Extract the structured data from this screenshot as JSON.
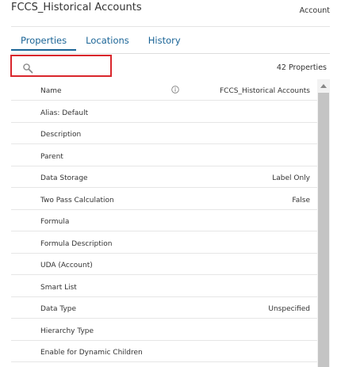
{
  "header": {
    "title": "FCCS_Historical Accounts",
    "member_type": "Account"
  },
  "tabs": [
    {
      "label": "Properties",
      "active": true
    },
    {
      "label": "Locations",
      "active": false
    },
    {
      "label": "History",
      "active": false
    }
  ],
  "search": {
    "icon": "search-icon",
    "value": "",
    "highlight_color": "#d9262c"
  },
  "property_count": "42 Properties",
  "properties": [
    {
      "name": "Name",
      "value": "FCCS_Historical Accounts",
      "has_info": true
    },
    {
      "name": "Alias: Default",
      "value": ""
    },
    {
      "name": "Description",
      "value": ""
    },
    {
      "name": "Parent",
      "value": ""
    },
    {
      "name": "Data Storage",
      "value": "Label Only"
    },
    {
      "name": "Two Pass Calculation",
      "value": "False"
    },
    {
      "name": "Formula",
      "value": ""
    },
    {
      "name": "Formula Description",
      "value": ""
    },
    {
      "name": "UDA (Account)",
      "value": ""
    },
    {
      "name": "Smart List",
      "value": ""
    },
    {
      "name": "Data Type",
      "value": "Unspecified"
    },
    {
      "name": "Hierarchy Type",
      "value": ""
    },
    {
      "name": "Enable for Dynamic Children",
      "value": ""
    }
  ],
  "colors": {
    "accent": "#1a6496",
    "search_border": "#d9262c"
  }
}
